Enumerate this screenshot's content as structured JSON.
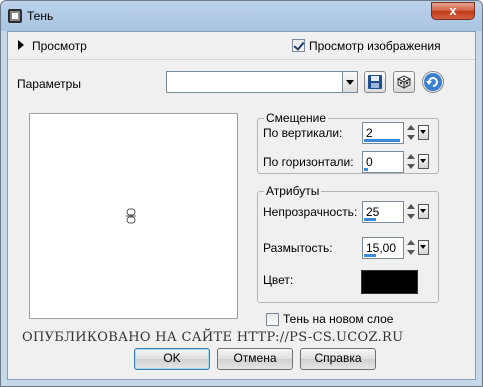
{
  "window": {
    "title": "Тень",
    "close_glyph": "x"
  },
  "preview_bar": {
    "label": "Просмотр",
    "preview_image_label": "Просмотр изображения",
    "preview_image_checked": true
  },
  "params": {
    "label": "Параметры",
    "preset_value": ""
  },
  "offset": {
    "title": "Смещение",
    "vertical_label": "По вертикали:",
    "vertical_value": "2",
    "horizontal_label": "По горизонтали:",
    "horizontal_value": "0"
  },
  "attributes": {
    "title": "Атрибуты",
    "opacity_label": "Непрозрачность:",
    "opacity_value": "25",
    "blur_label": "Размытость:",
    "blur_value": "15,00",
    "color_label": "Цвет:",
    "color_hex": "#000000"
  },
  "shadow_new_layer": {
    "label": "Тень на новом слое",
    "checked": false
  },
  "watermark": "ОПУБЛИКОВАНО   НА САЙТЕ   HTTP://PS-CS.UCOZ.RU",
  "buttons": {
    "ok": "OK",
    "cancel": "Отмена",
    "help": "Справка"
  },
  "colors": {
    "spin_bar": "#3b8bd9",
    "titlebar": "#a9c4e2",
    "close_button": "#c1381a"
  }
}
